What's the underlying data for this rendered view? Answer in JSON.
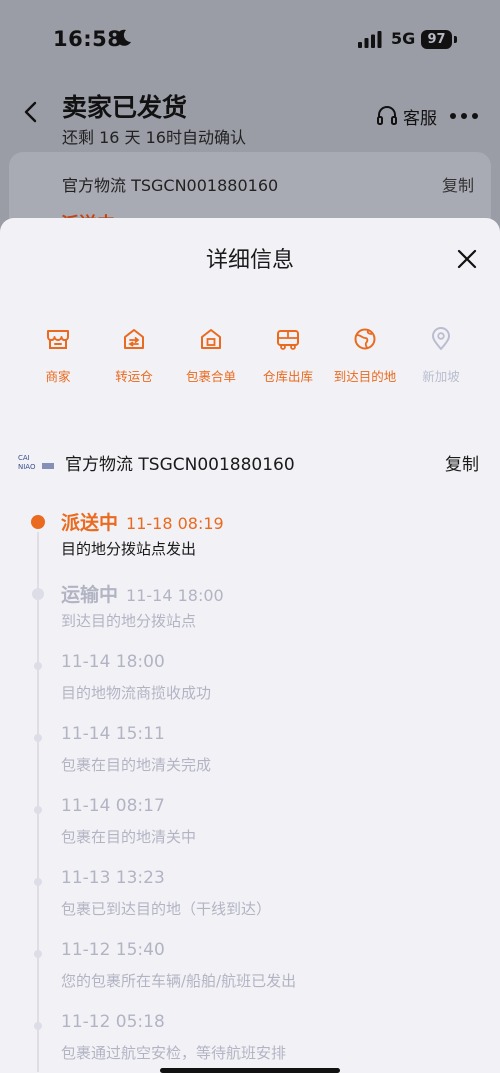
{
  "status_bar": {
    "time": "16:58",
    "network": "5G",
    "battery": "97"
  },
  "header": {
    "title": "卖家已发货",
    "subtitle": "还剩 16 天 16时自动确认",
    "service_label": "客服"
  },
  "bg_card": {
    "carrier_text": "官方物流 TSGCN001880160",
    "copy_label": "复制",
    "peek_status": "派送中"
  },
  "sheet": {
    "title": "详细信息",
    "steps": [
      {
        "label": "商家",
        "icon": "store-icon",
        "active": true
      },
      {
        "label": "转运仓",
        "icon": "transit-warehouse-icon",
        "active": true
      },
      {
        "label": "包裹合单",
        "icon": "package-merge-icon",
        "active": true
      },
      {
        "label": "仓库出库",
        "icon": "truck-icon",
        "active": true
      },
      {
        "label": "到达目的地",
        "icon": "globe-icon",
        "active": true
      },
      {
        "label": "新加坡",
        "icon": "location-pin-icon",
        "active": false
      }
    ],
    "carrier": {
      "logo_text_top": "CAI",
      "logo_text_bottom": "NIAO",
      "name": "官方物流 TSGCN001880160",
      "copy_label": "复制"
    },
    "events": [
      {
        "status": "派送中",
        "time": "11-18 08:19",
        "desc": "目的地分拨站点发出",
        "current": true
      },
      {
        "status": "运输中",
        "time": "11-14 18:00",
        "desc": "到达目的地分拨站点",
        "current": false
      },
      {
        "status": "",
        "time": "11-14 18:00",
        "desc": "目的地物流商揽收成功",
        "current": false
      },
      {
        "status": "",
        "time": "11-14 15:11",
        "desc": "包裹在目的地清关完成",
        "current": false
      },
      {
        "status": "",
        "time": "11-14 08:17",
        "desc": "包裹在目的地清关中",
        "current": false
      },
      {
        "status": "",
        "time": "11-13 13:23",
        "desc": "包裹已到达目的地（干线到达）",
        "current": false
      },
      {
        "status": "",
        "time": "11-12 15:40",
        "desc": "您的包裹所在车辆/船舶/航班已发出",
        "current": false
      },
      {
        "status": "",
        "time": "11-12 05:18",
        "desc": "包裹通过航空安检，等待航班安排",
        "current": false
      }
    ]
  },
  "colors": {
    "accent": "#ea6a1f",
    "inactive": "#b9bdcf",
    "past_text": "#b2b4c4",
    "current_desc": "#1a1a1a"
  }
}
